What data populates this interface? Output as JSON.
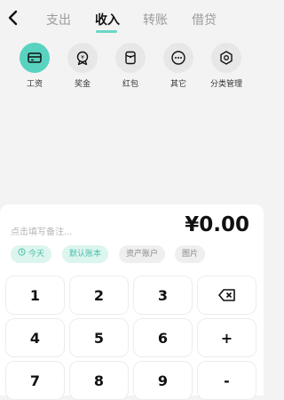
{
  "header": {
    "tabs": [
      {
        "label": "支出"
      },
      {
        "label": "收入"
      },
      {
        "label": "转账"
      },
      {
        "label": "借贷"
      }
    ],
    "active_tab": "收入"
  },
  "categories": [
    {
      "label": "工资",
      "icon": "card-icon",
      "selected": true
    },
    {
      "label": "奖金",
      "icon": "bonus-medal-icon",
      "selected": false
    },
    {
      "label": "红包",
      "icon": "red-envelope-icon",
      "selected": false
    },
    {
      "label": "其它",
      "icon": "more-dots-icon",
      "selected": false
    },
    {
      "label": "分类管理",
      "icon": "hexagon-settings-icon",
      "selected": false
    }
  ],
  "entry": {
    "note_placeholder": "点击填写备注...",
    "amount": "¥0.00"
  },
  "chips": [
    {
      "label": "今天",
      "style": "green",
      "icon": "clock-icon"
    },
    {
      "label": "默认账本",
      "style": "green"
    },
    {
      "label": "资产账户",
      "style": "gray"
    },
    {
      "label": "图片",
      "style": "gray"
    }
  ],
  "keypad": {
    "k1": "1",
    "k2": "2",
    "k3": "3",
    "backspace_icon": "backspace-icon",
    "k4": "4",
    "k5": "5",
    "k6": "6",
    "plus": "+",
    "k7": "7",
    "k8": "8",
    "k9": "9",
    "minus": "-"
  },
  "colors": {
    "accent": "#58d3c0",
    "chip_green_bg": "#dcf5ef",
    "chip_green_text": "#4bbfa9"
  }
}
